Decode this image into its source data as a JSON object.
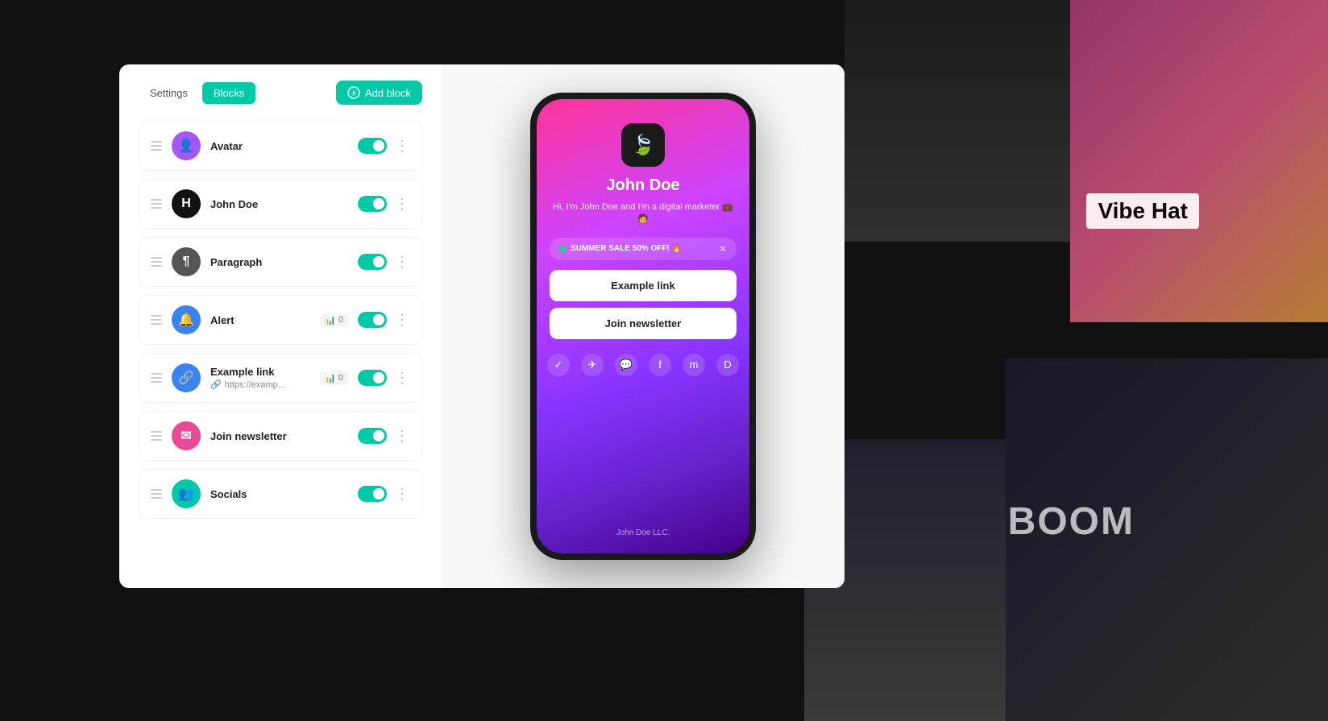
{
  "background": {
    "vibe_hat_label": "Vibe Hat",
    "boom_label": "BOOM"
  },
  "header": {
    "settings_tab": "Settings",
    "blocks_tab": "Blocks",
    "add_block_btn": "Add block"
  },
  "blocks": [
    {
      "id": "avatar",
      "title": "Avatar",
      "icon_bg": "#a855f7",
      "icon_char": "👤",
      "toggle_on": true,
      "badge": null,
      "subtitle": null
    },
    {
      "id": "john-doe",
      "title": "John Doe",
      "icon_bg": "#111",
      "icon_char": "H",
      "toggle_on": true,
      "badge": null,
      "subtitle": null
    },
    {
      "id": "paragraph",
      "title": "Paragraph",
      "icon_bg": "#555",
      "icon_char": "¶",
      "toggle_on": true,
      "badge": null,
      "subtitle": null
    },
    {
      "id": "alert",
      "title": "Alert",
      "icon_bg": "#3b82f6",
      "icon_char": "🔔",
      "toggle_on": true,
      "badge": "0",
      "subtitle": null
    },
    {
      "id": "example-link",
      "title": "Example link",
      "icon_bg": "#3b82f6",
      "icon_char": "🔗",
      "toggle_on": true,
      "badge": "0",
      "subtitle": "https://examp..."
    },
    {
      "id": "join-newsletter",
      "title": "Join newsletter",
      "icon_bg": "#ec4899",
      "icon_char": "✉",
      "toggle_on": true,
      "badge": null,
      "subtitle": null
    },
    {
      "id": "socials",
      "title": "Socials",
      "icon_bg": "#00c9a7",
      "icon_char": "👥",
      "toggle_on": true,
      "badge": null,
      "subtitle": null
    }
  ],
  "phone": {
    "app_icon": "🍃",
    "username": "John Doe",
    "bio": "Hi, I'm John Doe and I'm a digital\nmarketer 💼🧑",
    "alert_text": "SUMMER SALE 50% OFF! 🔥",
    "btn1_label": "Example link",
    "btn2_label": "Join newsletter",
    "footer": "John Doe LLC.",
    "socials": [
      "✓",
      "✈",
      "💬",
      "f",
      "m",
      "D"
    ]
  }
}
